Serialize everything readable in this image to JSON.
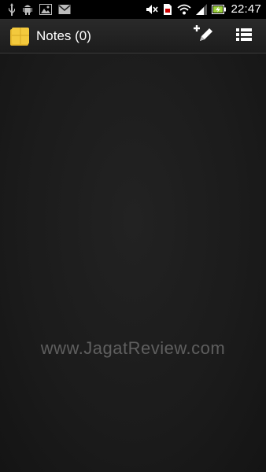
{
  "status_bar": {
    "left_icons": [
      "usb-icon",
      "android-icon",
      "image-icon",
      "gmail-icon"
    ],
    "right_icons": [
      "mute-icon",
      "sim-icon",
      "wifi-icon",
      "signal-icon",
      "battery-charging-icon"
    ],
    "time": "22:47"
  },
  "action_bar": {
    "app_icon": "notes-app-icon",
    "title": "Notes (0)",
    "new_note_icon": "add-note-icon",
    "menu_icon": "list-menu-icon"
  },
  "watermark": "www.JagatReview.com",
  "colors": {
    "background": "#1b1b1b",
    "action_bar": "#222222",
    "note_yellow": "#f3c93d"
  }
}
